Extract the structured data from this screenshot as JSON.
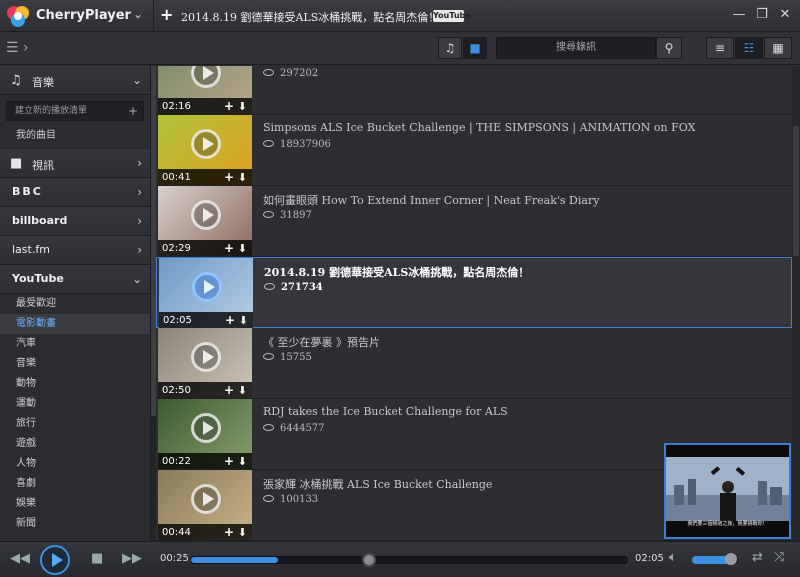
{
  "app": {
    "name": "CherryPlayer"
  },
  "titlebar": {
    "now_playing": "2014.8.19 劉德華接受ALS冰桶挑戰，點名周杰倫！",
    "source_badge": "YouTube",
    "minimize": "—",
    "restore": "❐",
    "close": "✕"
  },
  "toolbar": {
    "search_placeholder": "搜尋錄訊"
  },
  "sidebar": {
    "music_label": "音樂",
    "new_playlist_placeholder": "建立新的播放清單",
    "my_songs": "我的曲目",
    "video_label": "視訊",
    "bbc_label": "BBC",
    "billboard_label": "billboard",
    "lastfm_label": "last.fm",
    "youtube_label": "YouTube",
    "youtube_categories": [
      "最受歡迎",
      "電影動畫",
      "汽車",
      "音樂",
      "動物",
      "運動",
      "旅行",
      "遊戲",
      "人物",
      "喜劇",
      "娛樂",
      "新聞"
    ],
    "selected_category": 1
  },
  "videos": [
    {
      "title": "",
      "views": "297202",
      "duration": "02:16",
      "thumb_colors": [
        "#7a8a6a",
        "#b9a58a"
      ]
    },
    {
      "title": "Simpsons ALS Ice Bucket Challenge | THE SIMPSONS | ANIMATION on FOX",
      "views": "18937906",
      "duration": "00:41",
      "thumb_colors": [
        "#b0c23a",
        "#e0a020"
      ]
    },
    {
      "title": "如何畫眼頭 How To Extend Inner Corner | Neat Freak's Diary",
      "views": "31897",
      "duration": "02:29",
      "thumb_colors": [
        "#d8d0cc",
        "#8b6a5a"
      ]
    },
    {
      "title": "2014.8.19 劉德華接受ALS冰桶挑戰，點名周杰倫！",
      "views": "271734",
      "duration": "02:05",
      "thumb_colors": [
        "#6f9ac8",
        "#b8cde3"
      ],
      "selected": true
    },
    {
      "title": "《 至少在夢裏 》預告片",
      "views": "15755",
      "duration": "02:50",
      "thumb_colors": [
        "#8a8478",
        "#cfc6b8"
      ]
    },
    {
      "title": "RDJ takes the Ice Bucket Challenge for ALS",
      "views": "6444577",
      "duration": "00:22",
      "thumb_colors": [
        "#3a5a32",
        "#8aa070"
      ]
    },
    {
      "title": "張家輝 冰桶挑戰 ALS Ice Bucket Challenge",
      "views": "100133",
      "duration": "00:44",
      "thumb_colors": [
        "#8a7a5a",
        "#c8b48a"
      ]
    }
  ],
  "preview": {
    "caption": "我們要三個頻道之後，我要挑戰你！"
  },
  "player": {
    "elapsed": "00:25",
    "total": "02:05",
    "progress_fraction": 0.2,
    "volume_fraction": 0.85
  }
}
